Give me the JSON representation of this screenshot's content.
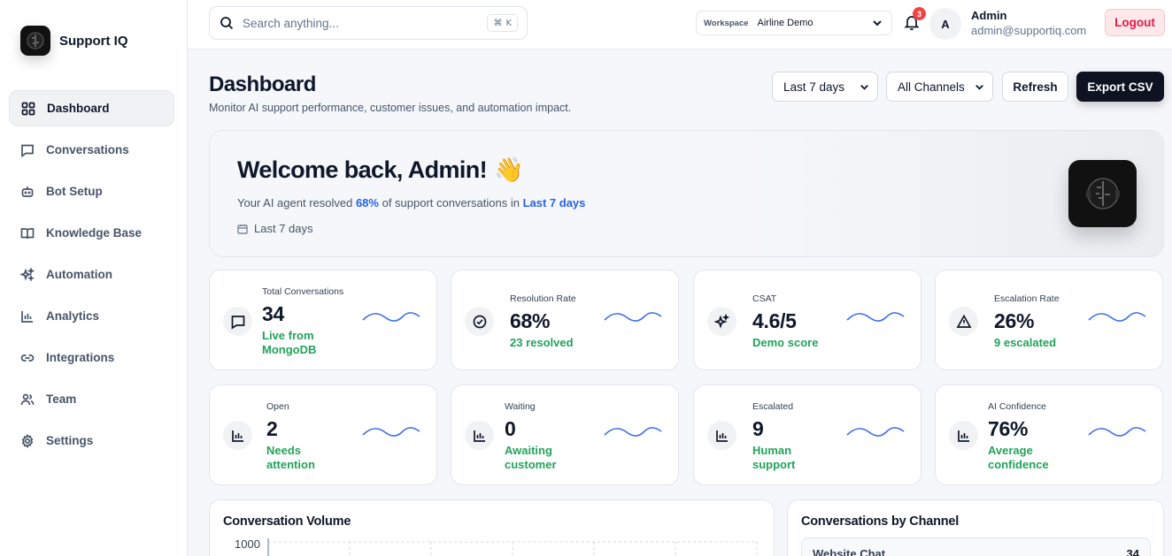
{
  "brand": {
    "name": "Support IQ"
  },
  "nav": [
    {
      "label": "Dashboard",
      "icon": "grid-icon",
      "active": true
    },
    {
      "label": "Conversations",
      "icon": "message-icon"
    },
    {
      "label": "Bot Setup",
      "icon": "bot-icon"
    },
    {
      "label": "Knowledge Base",
      "icon": "book-icon"
    },
    {
      "label": "Automation",
      "icon": "sparkle-icon"
    },
    {
      "label": "Analytics",
      "icon": "bar-chart-icon"
    },
    {
      "label": "Integrations",
      "icon": "link-icon"
    },
    {
      "label": "Team",
      "icon": "users-icon"
    },
    {
      "label": "Settings",
      "icon": "gear-icon"
    }
  ],
  "topbar": {
    "search_placeholder": "Search anything...",
    "shortcut_symbol": "⌘",
    "shortcut_key": "K",
    "workspace_label": "Workspace",
    "workspace_value": "Airline Demo",
    "notifications": "3",
    "avatar_letter": "A",
    "user_name": "Admin",
    "user_email": "admin@supportiq.com",
    "logout": "Logout"
  },
  "header": {
    "title": "Dashboard",
    "subtitle": "Monitor AI support performance, customer issues, and automation impact.",
    "range": "Last 7 days",
    "channel": "All Channels",
    "refresh": "Refresh",
    "export": "Export CSV"
  },
  "welcome": {
    "title": "Welcome back, Admin!",
    "emoji": "👋",
    "line_before": "Your AI agent resolved ",
    "pct": "68%",
    "line_mid": " of support conversations in ",
    "range": "Last 7 days",
    "date": "Last 7 days"
  },
  "stats": [
    {
      "label": "Total Conversations",
      "value": "34",
      "sub": "Live from MongoDB",
      "icon": "message-icon"
    },
    {
      "label": "Resolution Rate",
      "value": "68%",
      "sub": "23 resolved",
      "icon": "check-circle-icon"
    },
    {
      "label": "CSAT",
      "value": "4.6/5",
      "sub": "Demo score",
      "icon": "sparkle-icon"
    },
    {
      "label": "Escalation Rate",
      "value": "26%",
      "sub": "9 escalated",
      "icon": "warning-icon"
    },
    {
      "label": "Open",
      "value": "2",
      "sub": "Needs attention",
      "icon": "bar-chart-icon"
    },
    {
      "label": "Waiting",
      "value": "0",
      "sub": "Awaiting customer",
      "icon": "bar-chart-icon"
    },
    {
      "label": "Escalated",
      "value": "9",
      "sub": "Human support",
      "icon": "bar-chart-icon"
    },
    {
      "label": "AI Confidence",
      "value": "76%",
      "sub": "Average confidence",
      "icon": "bar-chart-icon"
    }
  ],
  "panels": {
    "volume_title": "Conversation Volume",
    "volume_tick": "1000",
    "channel_title": "Conversations by Channel",
    "channel_row_label": "Website Chat",
    "channel_row_value": "34"
  },
  "colors": {
    "accent": "#2563eb",
    "success": "#22a35a",
    "danger": "#ef4444"
  }
}
